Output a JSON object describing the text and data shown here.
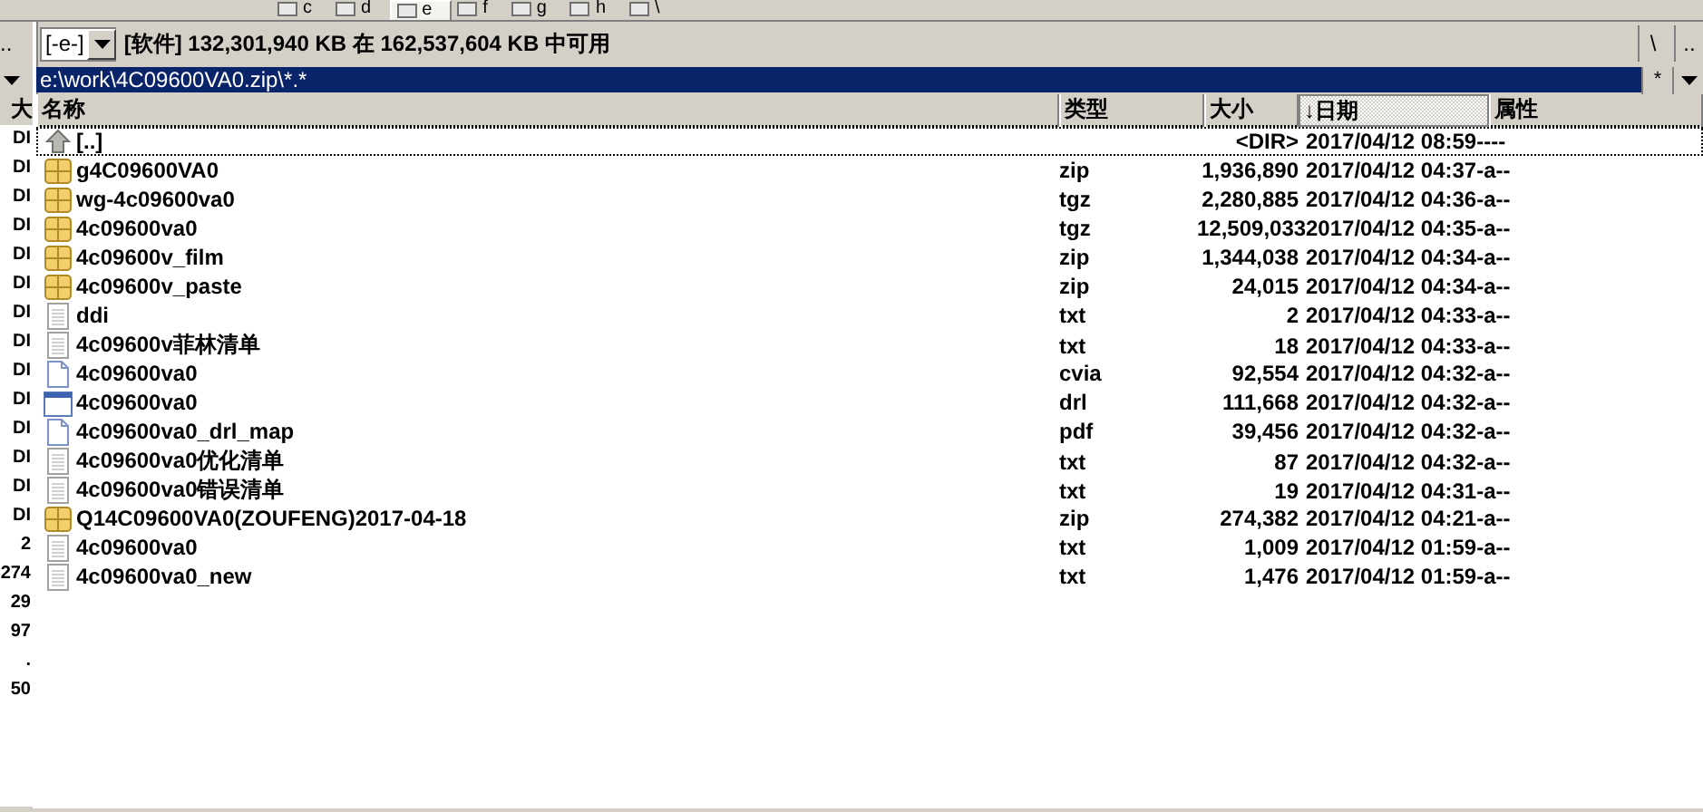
{
  "drive_bar": [
    {
      "label": "c",
      "selected": false
    },
    {
      "label": "d",
      "selected": false
    },
    {
      "label": "e",
      "selected": true
    },
    {
      "label": "f",
      "selected": false
    },
    {
      "label": "g",
      "selected": false
    },
    {
      "label": "h",
      "selected": false
    },
    {
      "label": "\\",
      "selected": false
    }
  ],
  "left_pane": {
    "menu": "..",
    "header": "大",
    "cells": [
      "DI",
      "DI",
      "DI",
      "DI",
      "DI",
      "DI",
      "DI",
      "DI",
      "DI",
      "DI",
      "DI",
      "DI",
      "DI",
      "DI",
      "2",
      "274",
      "29",
      "97",
      ".",
      "50"
    ]
  },
  "drive_info": {
    "drive": "[-e-]",
    "free_space": "[软件] 132,301,940 KB 在 162,537,604 KB 中可用",
    "buttons": [
      "\\",
      ".."
    ]
  },
  "path": {
    "text": "e:\\work\\4C09600VA0.zip\\*.*",
    "buttons": [
      "*"
    ]
  },
  "columns": [
    {
      "label": "名称",
      "sorted": false
    },
    {
      "label": "类型",
      "sorted": false
    },
    {
      "label": "大小",
      "sorted": false
    },
    {
      "label": "↓日期",
      "sorted": true
    },
    {
      "label": "属性",
      "sorted": false
    }
  ],
  "files": [
    {
      "kind": "up",
      "name": "[..]",
      "size": "<DIR>",
      "date": "2017/04/12 08:59",
      "attributes": "----"
    },
    {
      "kind": "archive",
      "name": "g4C09600VA0",
      "type": "zip",
      "size": "1,936,890",
      "date": "2017/04/12 04:37",
      "attributes": "-a--"
    },
    {
      "kind": "archive",
      "name": "wg-4c09600va0",
      "type": "tgz",
      "size": "2,280,885",
      "date": "2017/04/12 04:36",
      "attributes": "-a--"
    },
    {
      "kind": "archive",
      "name": "4c09600va0",
      "type": "tgz",
      "size": "12,509,033",
      "date": "2017/04/12 04:35",
      "attributes": "-a--"
    },
    {
      "kind": "archive",
      "name": "4c09600v_film",
      "type": "zip",
      "size": "1,344,038",
      "date": "2017/04/12 04:34",
      "attributes": "-a--"
    },
    {
      "kind": "archive",
      "name": "4c09600v_paste",
      "type": "zip",
      "size": "24,015",
      "date": "2017/04/12 04:34",
      "attributes": "-a--"
    },
    {
      "kind": "text",
      "name": "ddi",
      "type": "txt",
      "size": "2",
      "date": "2017/04/12 04:33",
      "attributes": "-a--"
    },
    {
      "kind": "text",
      "name": "4c09600v菲林清单",
      "type": "txt",
      "size": "18",
      "date": "2017/04/12 04:33",
      "attributes": "-a--"
    },
    {
      "kind": "file",
      "name": "4c09600va0",
      "type": "cvia",
      "size": "92,554",
      "date": "2017/04/12 04:32",
      "attributes": "-a--"
    },
    {
      "kind": "window",
      "name": "4c09600va0",
      "type": "drl",
      "size": "111,668",
      "date": "2017/04/12 04:32",
      "attributes": "-a--"
    },
    {
      "kind": "file",
      "name": "4c09600va0_drl_map",
      "type": "pdf",
      "size": "39,456",
      "date": "2017/04/12 04:32",
      "attributes": "-a--"
    },
    {
      "kind": "text",
      "name": "4c09600va0优化清单",
      "type": "txt",
      "size": "87",
      "date": "2017/04/12 04:32",
      "attributes": "-a--"
    },
    {
      "kind": "text",
      "name": "4c09600va0错误清单",
      "type": "txt",
      "size": "19",
      "date": "2017/04/12 04:31",
      "attributes": "-a--"
    },
    {
      "kind": "archive",
      "name": "Q14C09600VA0(ZOUFENG)2017-04-18",
      "type": "zip",
      "size": "274,382",
      "date": "2017/04/12 04:21",
      "attributes": "-a--"
    },
    {
      "kind": "text",
      "name": "4c09600va0",
      "type": "txt",
      "size": "1,009",
      "date": "2017/04/12 01:59",
      "attributes": "-a--"
    },
    {
      "kind": "text",
      "name": "4c09600va0_new",
      "type": "txt",
      "size": "1,476",
      "date": "2017/04/12 01:59",
      "attributes": "-a--"
    }
  ]
}
